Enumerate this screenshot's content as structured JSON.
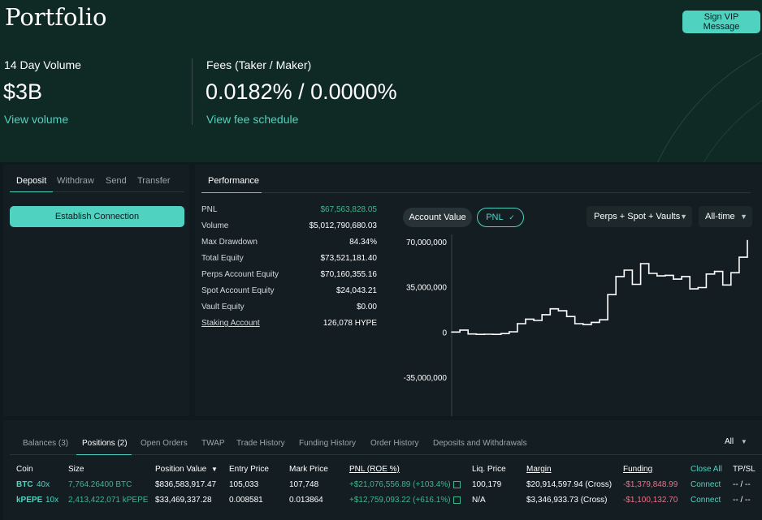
{
  "page": {
    "title": "Portfolio",
    "vip_button": "Sign VIP Message"
  },
  "stats": {
    "volume": {
      "label": "14 Day Volume",
      "value": "$3B",
      "link": "View volume"
    },
    "fees": {
      "label": "Fees (Taker / Maker)",
      "value": "0.0182% / 0.0000%",
      "link": "View fee schedule"
    }
  },
  "account_panel": {
    "tabs": [
      "Deposit",
      "Withdraw",
      "Send",
      "Transfer"
    ],
    "active_tab": "Deposit",
    "button": "Establish Connection"
  },
  "performance": {
    "tab": "Performance",
    "rows": [
      {
        "label": "PNL",
        "value": "$67,563,828.05"
      },
      {
        "label": "Volume",
        "value": "$5,012,790,680.03"
      },
      {
        "label": "Max Drawdown",
        "value": "84.34%"
      },
      {
        "label": "Total Equity",
        "value": "$73,521,181.40"
      },
      {
        "label": "Perps Account Equity",
        "value": "$70,160,355.16"
      },
      {
        "label": "Spot Account Equity",
        "value": "$24,043.21"
      },
      {
        "label": "Vault Equity",
        "value": "$0.00"
      },
      {
        "label": "Staking Account",
        "value": "126,078 HYPE"
      }
    ],
    "toggle": {
      "account_value": "Account Value",
      "pnl": "PNL"
    },
    "scope_select": "Perps + Spot + Vaults",
    "range_select": "All-time",
    "colors": {
      "accent": "#50d2c1",
      "positive": "#3fb58c",
      "negative": "#ed7088"
    }
  },
  "chart_data": {
    "type": "line",
    "series": [
      {
        "values": [
          0,
          1500000,
          -1500000,
          -1800000,
          -1700000,
          -1800000,
          -1200000,
          200000,
          6500000,
          10000000,
          9000000,
          13500000,
          18000000,
          16500000,
          12000000,
          6500000,
          5800000,
          7500000,
          9500000,
          29000000,
          43000000,
          48000000,
          37000000,
          53000000,
          45500000,
          43500000,
          44000000,
          41000000,
          43000000,
          33500000,
          34500000,
          45000000,
          47000000,
          36500000,
          46000000,
          58000000,
          71000000
        ]
      }
    ],
    "ylim": [
      -35000000,
      70000000
    ],
    "yticks": [
      "70,000,000",
      "35,000,000",
      "0",
      "-35,000,000"
    ],
    "grid": false
  },
  "bottom": {
    "tabs": [
      "Balances (3)",
      "Positions (2)",
      "Open Orders",
      "TWAP",
      "Trade History",
      "Funding History",
      "Order History",
      "Deposits and Withdrawals"
    ],
    "active_tab": "Positions (2)",
    "filter": "All",
    "columns": [
      "Coin",
      "Size",
      "Position Value",
      "Entry Price",
      "Mark Price",
      "PNL (ROE %)",
      "Liq. Price",
      "Margin",
      "Funding",
      "Close All",
      "TP/SL"
    ],
    "rows": [
      {
        "coin": "BTC",
        "leverage": "40x",
        "size": "7,764.26400 BTC",
        "position_value": "$836,583,917.47",
        "entry_price": "105,033",
        "mark_price": "107,748",
        "pnl": "+$21,076,556.89 (+103.4%)",
        "liq_price": "100,179",
        "margin": "$20,914,597.94 (Cross)",
        "funding": "-$1,379,848.99",
        "close": "Connect",
        "tpsl": "-- / --"
      },
      {
        "coin": "kPEPE",
        "leverage": "10x",
        "size": "2,413,422,071 kPEPE",
        "position_value": "$33,469,337.28",
        "entry_price": "0.008581",
        "mark_price": "0.013864",
        "pnl": "+$12,759,093.22 (+616.1%)",
        "liq_price": "N/A",
        "margin": "$3,346,933.73 (Cross)",
        "funding": "-$1,100,132.70",
        "close": "Connect",
        "tpsl": "-- / --"
      }
    ]
  }
}
